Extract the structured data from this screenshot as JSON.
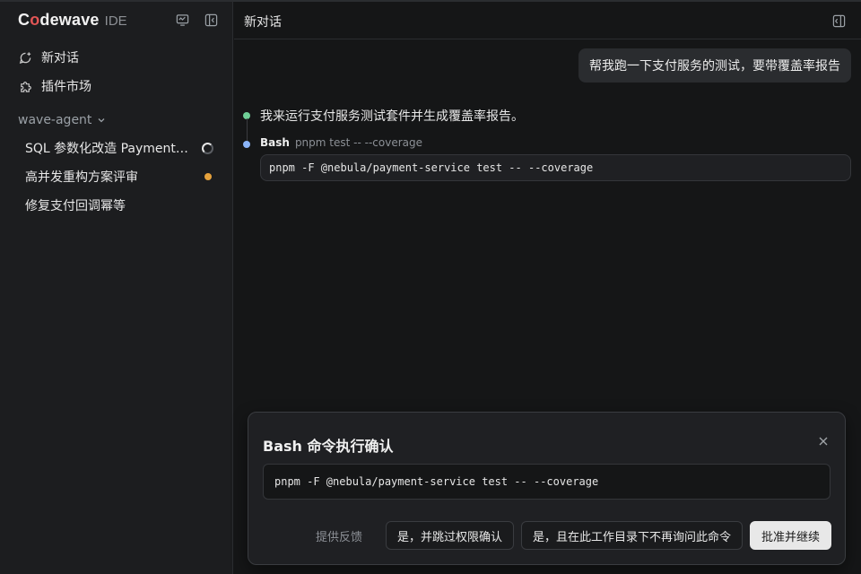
{
  "brand": {
    "name_pre": "C",
    "name_o": "o",
    "name_post": "dewave",
    "suffix": "IDE"
  },
  "sidebar": {
    "nav": [
      {
        "label": "新对话",
        "icon": "new-chat-icon"
      },
      {
        "label": "插件市场",
        "icon": "puzzle-icon"
      }
    ],
    "section_label": "wave-agent",
    "sessions": [
      {
        "label": "SQL 参数化改造 PaymentService",
        "status": "running"
      },
      {
        "label": "高并发重构方案评审",
        "status": "unread"
      },
      {
        "label": "修复支付回调幂等",
        "status": "none"
      }
    ]
  },
  "topbar": {
    "title": "新对话"
  },
  "conversation": {
    "user_message": "帮我跑一下支付服务的测试，要带覆盖率报告",
    "assistant_message": "我来运行支付服务测试套件并生成覆盖率报告。",
    "tool_call": {
      "name": "Bash",
      "description": "pnpm test -- --coverage",
      "command": "pnpm -F @nebula/payment-service test -- --coverage"
    }
  },
  "dialog": {
    "title": "Bash 命令执行确认",
    "command": "pnpm -F @nebula/payment-service test -- --coverage",
    "feedback_label": "提供反馈",
    "skip_label": "是，并跳过权限确认",
    "remember_label": "是，且在此工作目录下不再询问此命令",
    "approve_label": "批准并继续"
  },
  "colors": {
    "accent_brand": "#e25555",
    "dot_green": "#6fcf97",
    "dot_blue": "#8ab4f8",
    "dot_orange": "#e6a23c"
  }
}
